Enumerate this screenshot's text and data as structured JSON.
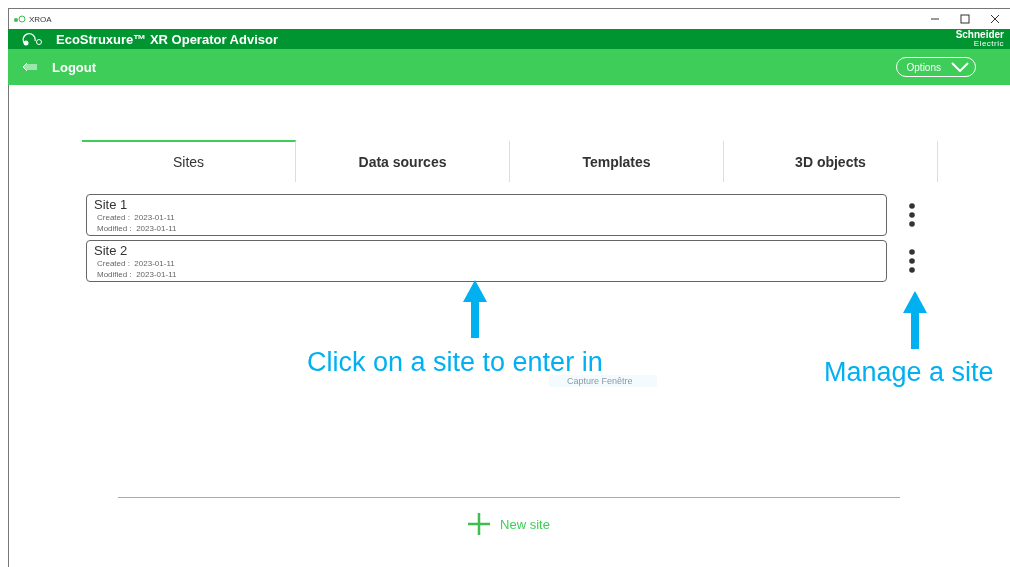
{
  "window": {
    "title": "XROA"
  },
  "app": {
    "title": "EcoStruxure™ XR Operator Advisor",
    "brand": "Schneider",
    "brand_sub": "Electric"
  },
  "toolbar": {
    "logout": "Logout",
    "options": "Options"
  },
  "tabs": [
    {
      "label": "Sites",
      "selected": true
    },
    {
      "label": "Data sources",
      "selected": false
    },
    {
      "label": "Templates",
      "selected": false
    },
    {
      "label": "3D objects",
      "selected": false
    }
  ],
  "sites": [
    {
      "name": "Site 1",
      "created_label": "Created :",
      "created": "2023-01-11",
      "modified_label": "Modified :",
      "modified": "2023-01-11"
    },
    {
      "name": "Site 2",
      "created_label": "Created :",
      "created": "2023-01-11",
      "modified_label": "Modified :",
      "modified": "2023-01-11"
    }
  ],
  "overlay_tooltip": "Capture Fenêtre",
  "annotations": [
    {
      "text": "Click on a site to enter in"
    },
    {
      "text": "Manage a site"
    }
  ],
  "new_site": "New site"
}
